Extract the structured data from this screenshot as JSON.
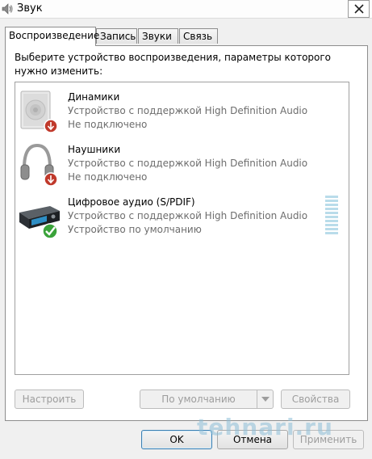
{
  "window": {
    "title": "Звук"
  },
  "tabs": [
    {
      "label": "Воспроизведение",
      "active": true
    },
    {
      "label": "Запись",
      "active": false
    },
    {
      "label": "Звуки",
      "active": false
    },
    {
      "label": "Связь",
      "active": false
    }
  ],
  "instruction": "Выберите устройство воспроизведения, параметры которого нужно изменить:",
  "devices": [
    {
      "name": "Динамики",
      "description": "Устройство с поддержкой High Definition Audio",
      "status": "Не подключено",
      "icon": "speaker-icon",
      "badge": "disconnected-badge-icon"
    },
    {
      "name": "Наушники",
      "description": "Устройство с поддержкой High Definition Audio",
      "status": "Не подключено",
      "icon": "headphones-icon",
      "badge": "disconnected-badge-icon"
    },
    {
      "name": "Цифровое аудио (S/PDIF)",
      "description": "Устройство с поддержкой High Definition Audio",
      "status": "Устройство по умолчанию",
      "icon": "digital-audio-receiver-icon",
      "badge": "default-check-icon"
    }
  ],
  "buttons": {
    "configure": "Настроить",
    "set_default": "По умолчанию",
    "properties": "Свойства",
    "ok": "OK",
    "cancel": "Отмена",
    "apply": "Применить"
  },
  "watermark": "tehnari.ru",
  "colors": {
    "accent": "#3c7fb1",
    "vu_meter": "#b9dcea",
    "secondary_text": "#6d6d6d"
  }
}
